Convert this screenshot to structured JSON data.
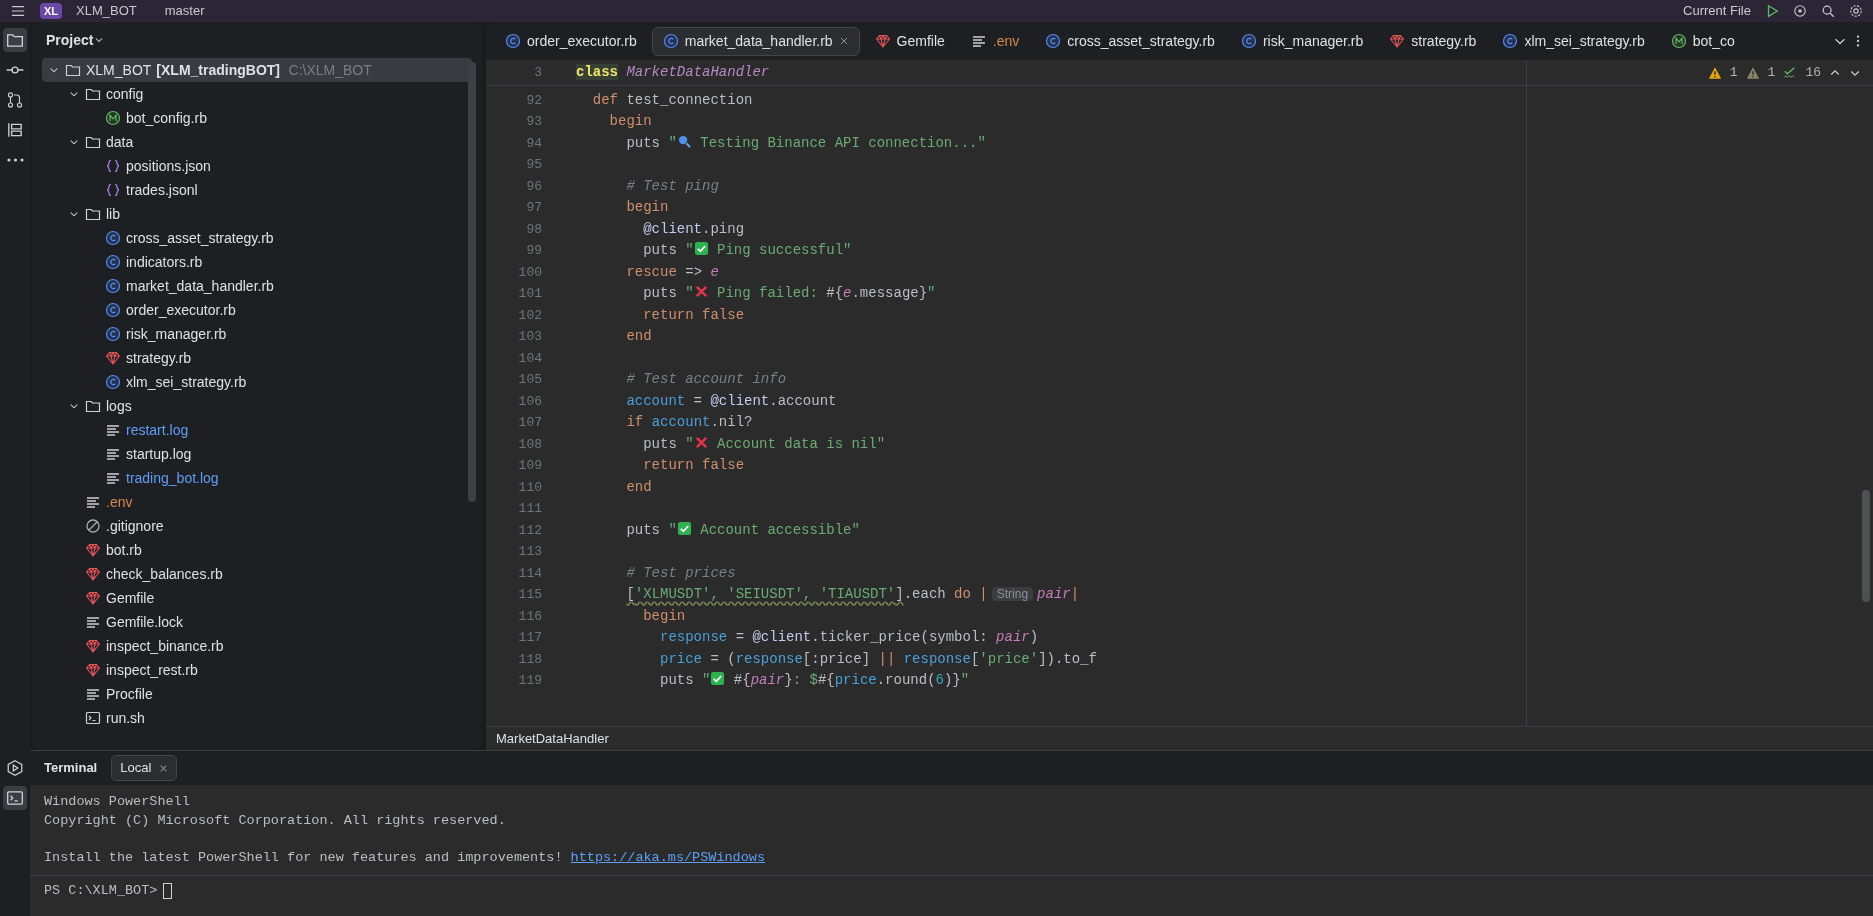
{
  "title_bar": {
    "project_badge": "XL",
    "project": "XLM_BOT",
    "branch": "master",
    "run_config": "Current File"
  },
  "tool_strip": {
    "top": [
      {
        "kind": "folder",
        "selected": true
      },
      {
        "kind": "commit",
        "selected": false
      },
      {
        "kind": "pull",
        "selected": false
      },
      {
        "kind": "structure",
        "selected": false
      },
      {
        "kind": "more",
        "selected": false
      }
    ],
    "bottom": [
      {
        "kind": "run",
        "selected": false
      },
      {
        "kind": "terminal",
        "selected": true
      }
    ]
  },
  "project_panel": {
    "title": "Project",
    "tree": [
      {
        "name": "XLM_BOT",
        "extra": "[XLM_tradingBOT]",
        "path": "C:\\XLM_BOT",
        "kind": "folder",
        "expanded": true,
        "selected": true,
        "children": [
          {
            "name": "config",
            "kind": "folder",
            "expanded": true,
            "selected": false,
            "children": [
              {
                "name": "bot_config.rb",
                "kind": "module",
                "selected": false
              }
            ]
          },
          {
            "name": "data",
            "kind": "folder",
            "expanded": true,
            "selected": false,
            "children": [
              {
                "name": "positions.json",
                "kind": "json",
                "selected": false
              },
              {
                "name": "trades.jsonl",
                "kind": "json",
                "selected": false
              }
            ]
          },
          {
            "name": "lib",
            "kind": "folder",
            "expanded": true,
            "selected": false,
            "children": [
              {
                "name": "cross_asset_strategy.rb",
                "kind": "class",
                "selected": false
              },
              {
                "name": "indicators.rb",
                "kind": "class",
                "selected": false
              },
              {
                "name": "market_data_handler.rb",
                "kind": "class",
                "selected": false
              },
              {
                "name": "order_executor.rb",
                "kind": "class",
                "selected": false
              },
              {
                "name": "risk_manager.rb",
                "kind": "class",
                "selected": false
              },
              {
                "name": "strategy.rb",
                "kind": "ruby",
                "selected": false
              },
              {
                "name": "xlm_sei_strategy.rb",
                "kind": "class",
                "selected": false
              }
            ]
          },
          {
            "name": "logs",
            "kind": "folder",
            "expanded": true,
            "selected": false,
            "children": [
              {
                "name": "restart.log",
                "kind": "text",
                "color": "#5e9ff5",
                "selected": false
              },
              {
                "name": "startup.log",
                "kind": "text",
                "selected": false
              },
              {
                "name": "trading_bot.log",
                "kind": "text",
                "color": "#5e9ff5",
                "selected": false
              }
            ]
          },
          {
            "name": ".env",
            "kind": "text",
            "color": "#d08a52",
            "selected": false
          },
          {
            "name": ".gitignore",
            "kind": "ignore",
            "selected": false
          },
          {
            "name": "bot.rb",
            "kind": "ruby",
            "selected": false
          },
          {
            "name": "check_balances.rb",
            "kind": "ruby",
            "selected": false
          },
          {
            "name": "Gemfile",
            "kind": "ruby",
            "selected": false
          },
          {
            "name": "Gemfile.lock",
            "kind": "text",
            "selected": false
          },
          {
            "name": "inspect_binance.rb",
            "kind": "ruby",
            "selected": false
          },
          {
            "name": "inspect_rest.rb",
            "kind": "ruby",
            "selected": false
          },
          {
            "name": "Procfile",
            "kind": "text",
            "selected": false
          },
          {
            "name": "run.sh",
            "kind": "shell",
            "selected": false
          }
        ]
      }
    ]
  },
  "editor": {
    "tabs": [
      {
        "label": "order_executor.rb",
        "kind": "class",
        "selected": false
      },
      {
        "label": "market_data_handler.rb",
        "kind": "class",
        "selected": true
      },
      {
        "label": "Gemfile",
        "kind": "ruby",
        "selected": false
      },
      {
        "label": ".env",
        "kind": "text",
        "color": "#d08a52",
        "selected": false
      },
      {
        "label": "cross_asset_strategy.rb",
        "kind": "class",
        "selected": false
      },
      {
        "label": "risk_manager.rb",
        "kind": "class",
        "selected": false
      },
      {
        "label": "strategy.rb",
        "kind": "ruby",
        "selected": false
      },
      {
        "label": "xlm_sei_strategy.rb",
        "kind": "class",
        "selected": false
      },
      {
        "label": "bot_co",
        "kind": "module",
        "selected": false
      }
    ],
    "inspections": {
      "warnings": "1",
      "weak_warnings": "1",
      "typos": "16"
    },
    "sticky": {
      "n": "3",
      "tokens": [
        {
          "text": "class",
          "kind": "kwhl"
        },
        {
          "text": " MarketDataHandler",
          "kind": "cls"
        }
      ]
    },
    "lines": [
      {
        "n": "92",
        "tokens": [
          {
            "text": "  def",
            "kind": "kw"
          },
          {
            "text": " test_connection",
            "kind": "plain"
          }
        ]
      },
      {
        "n": "93",
        "tokens": [
          {
            "text": "    begin",
            "kind": "kw"
          }
        ]
      },
      {
        "n": "94",
        "tokens": [
          {
            "text": "      puts ",
            "kind": "plain"
          },
          {
            "text": "\"",
            "kind": "str"
          },
          {
            "kind": "search"
          },
          {
            "text": " Testing Binance API connection...\"",
            "kind": "str"
          }
        ]
      },
      {
        "n": "95"
      },
      {
        "n": "96",
        "tokens": [
          {
            "text": "      # Test ping",
            "kind": "com"
          }
        ]
      },
      {
        "n": "97",
        "tokens": [
          {
            "text": "      begin",
            "kind": "kw"
          }
        ]
      },
      {
        "n": "98",
        "tokens": [
          {
            "text": "        @client",
            "kind": "ivar"
          },
          {
            "text": ".ping",
            "kind": "plain"
          }
        ]
      },
      {
        "n": "99",
        "tokens": [
          {
            "text": "        puts ",
            "kind": "plain"
          },
          {
            "text": "\"",
            "kind": "str"
          },
          {
            "kind": "check"
          },
          {
            "text": " Ping successful\"",
            "kind": "str"
          }
        ]
      },
      {
        "n": "100",
        "tokens": [
          {
            "text": "      rescue",
            "kind": "kw"
          },
          {
            "text": " => ",
            "kind": "plain"
          },
          {
            "text": "e",
            "kind": "param"
          }
        ]
      },
      {
        "n": "101",
        "tokens": [
          {
            "text": "        puts ",
            "kind": "plain"
          },
          {
            "text": "\"",
            "kind": "str"
          },
          {
            "kind": "cross"
          },
          {
            "text": " Ping failed: ",
            "kind": "str"
          },
          {
            "text": "#{",
            "kind": "plain"
          },
          {
            "text": "e",
            "kind": "param"
          },
          {
            "text": ".message}",
            "kind": "plain"
          },
          {
            "text": "\"",
            "kind": "str"
          }
        ]
      },
      {
        "n": "102",
        "tokens": [
          {
            "text": "        return false",
            "kind": "kw"
          }
        ]
      },
      {
        "n": "103",
        "tokens": [
          {
            "text": "      end",
            "kind": "kw"
          }
        ]
      },
      {
        "n": "104"
      },
      {
        "n": "105",
        "tokens": [
          {
            "text": "      # Test account info",
            "kind": "com"
          }
        ]
      },
      {
        "n": "106",
        "tokens": [
          {
            "text": "      account",
            "kind": "var"
          },
          {
            "text": " = ",
            "kind": "plain"
          },
          {
            "text": "@client",
            "kind": "ivar"
          },
          {
            "text": ".account",
            "kind": "plain"
          }
        ]
      },
      {
        "n": "107",
        "tokens": [
          {
            "text": "      if ",
            "kind": "kw"
          },
          {
            "text": "account",
            "kind": "var"
          },
          {
            "text": ".nil?",
            "kind": "plain"
          }
        ]
      },
      {
        "n": "108",
        "tokens": [
          {
            "text": "        puts ",
            "kind": "plain"
          },
          {
            "text": "\"",
            "kind": "str"
          },
          {
            "kind": "cross"
          },
          {
            "text": " Account data is nil\"",
            "kind": "str"
          }
        ]
      },
      {
        "n": "109",
        "tokens": [
          {
            "text": "        return false",
            "kind": "kw"
          }
        ]
      },
      {
        "n": "110",
        "tokens": [
          {
            "text": "      end",
            "kind": "kw"
          }
        ]
      },
      {
        "n": "111"
      },
      {
        "n": "112",
        "tokens": [
          {
            "text": "      puts ",
            "kind": "plain"
          },
          {
            "text": "\"",
            "kind": "str"
          },
          {
            "kind": "check"
          },
          {
            "text": " Account accessible\"",
            "kind": "str"
          }
        ]
      },
      {
        "n": "113"
      },
      {
        "n": "114",
        "tokens": [
          {
            "text": "      # Test prices",
            "kind": "com"
          }
        ]
      },
      {
        "n": "115",
        "tokens": [
          {
            "text": "      [",
            "kind": "plain",
            "typo": true
          },
          {
            "text": "'XLMUSDT', 'SEIUSDT', 'TIAUSDT'",
            "kind": "str",
            "typo": true
          },
          {
            "text": "]",
            "kind": "plain",
            "typo": true
          },
          {
            "text": ".each ",
            "kind": "plain"
          },
          {
            "text": "do",
            "kind": "kw"
          },
          {
            "text": " |",
            "kind": "kw"
          },
          {
            "text": "String",
            "kind": "hint"
          },
          {
            "text": "pair",
            "kind": "param"
          },
          {
            "text": "|",
            "kind": "kw"
          }
        ]
      },
      {
        "n": "116",
        "tokens": [
          {
            "text": "        begin",
            "kind": "kw"
          }
        ]
      },
      {
        "n": "117",
        "tokens": [
          {
            "text": "          response",
            "kind": "var"
          },
          {
            "text": " = ",
            "kind": "plain"
          },
          {
            "text": "@client",
            "kind": "ivar"
          },
          {
            "text": ".ticker_price(symbol: ",
            "kind": "plain"
          },
          {
            "text": "pair",
            "kind": "param"
          },
          {
            "text": ")",
            "kind": "plain"
          }
        ]
      },
      {
        "n": "118",
        "tokens": [
          {
            "text": "          price",
            "kind": "var"
          },
          {
            "text": " = (",
            "kind": "plain"
          },
          {
            "text": "response",
            "kind": "var"
          },
          {
            "text": "[:price] ",
            "kind": "plain"
          },
          {
            "text": "|| ",
            "kind": "kw"
          },
          {
            "text": "response",
            "kind": "var"
          },
          {
            "text": "[",
            "kind": "plain"
          },
          {
            "text": "'price'",
            "kind": "str"
          },
          {
            "text": "]).to_f",
            "kind": "plain"
          }
        ]
      },
      {
        "n": "119",
        "tokens": [
          {
            "text": "          puts ",
            "kind": "plain"
          },
          {
            "text": "\"",
            "kind": "str"
          },
          {
            "kind": "check"
          },
          {
            "text": " #{",
            "kind": "plain"
          },
          {
            "text": "pair",
            "kind": "param"
          },
          {
            "text": "}",
            "kind": "plain"
          },
          {
            "text": ": $",
            "kind": "str"
          },
          {
            "text": "#{",
            "kind": "plain"
          },
          {
            "text": "price",
            "kind": "var"
          },
          {
            "text": ".round(",
            "kind": "plain"
          },
          {
            "text": "6",
            "kind": "num"
          },
          {
            "text": ")}",
            "kind": "plain"
          },
          {
            "text": "\"",
            "kind": "str"
          }
        ]
      }
    ],
    "breadcrumb": "MarketDataHandler"
  },
  "terminal": {
    "title": "Terminal",
    "tabs": [
      {
        "label": "Local",
        "selected": true
      }
    ],
    "output": [
      {
        "kind": "text",
        "text": "Windows PowerShell"
      },
      {
        "kind": "text",
        "text": "Copyright (C) Microsoft Corporation. All rights reserved."
      },
      {
        "kind": "blank"
      },
      {
        "kind": "text_link",
        "text": "Install the latest PowerShell for new features and improvements! ",
        "link": "https://aka.ms/PSWindows"
      }
    ],
    "prompt": "PS C:\\XLM_BOT>"
  }
}
